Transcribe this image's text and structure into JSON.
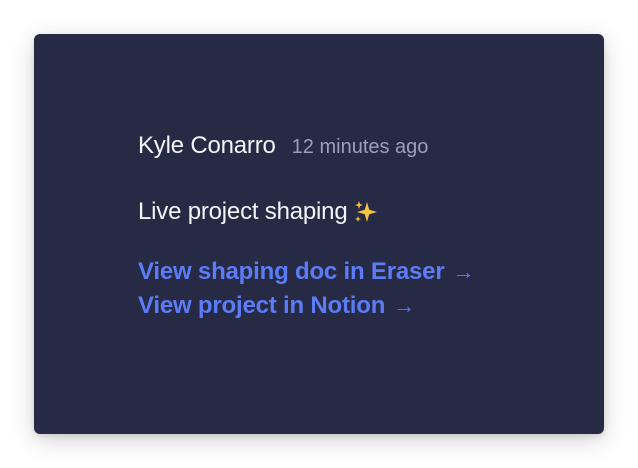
{
  "comment": {
    "author": "Kyle Conarro",
    "timestamp": "12 minutes ago",
    "message": "Live project shaping",
    "message_icon": "sparkles-icon",
    "links": [
      {
        "label": "View shaping doc in Eraser",
        "arrow": "→"
      },
      {
        "label": "View project in Notion",
        "arrow": "→"
      }
    ]
  },
  "colors": {
    "card_background": "#262a45",
    "primary_text": "#f3f4f8",
    "muted_text": "#9aa0b8",
    "link": "#5b7cf6",
    "sparkle": "#f5c542"
  }
}
